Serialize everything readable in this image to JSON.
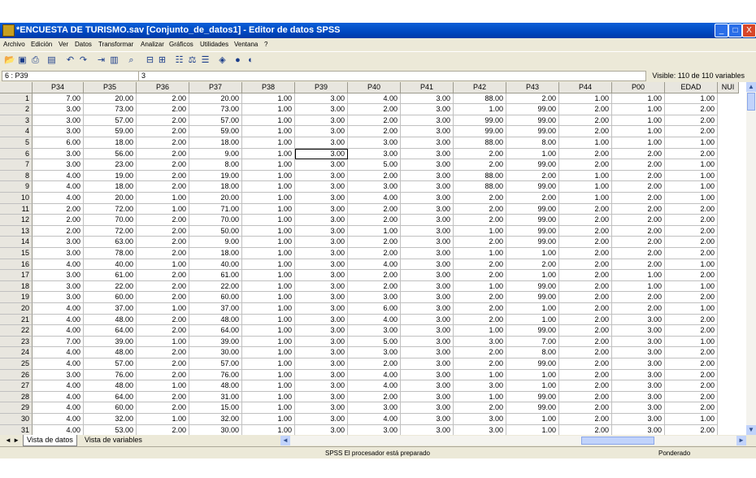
{
  "window": {
    "title": "*ENCUESTA DE TURISMO.sav [Conjunto_de_datos1] - Editor de datos SPSS",
    "buttons": [
      "_",
      "□",
      "X"
    ]
  },
  "menu": [
    "Archivo",
    "Edición",
    "Ver",
    "Datos",
    "Transformar",
    "Analizar",
    "Gráficos",
    "Utilidades",
    "Ventana",
    "?"
  ],
  "toolbar": [
    "open-icon",
    "save-icon",
    "print-icon",
    "dialog-recall-icon",
    "undo-icon",
    "redo-icon",
    "goto-case-icon",
    "variables-icon",
    "find-icon",
    "insert-cases-icon",
    "insert-variable-icon",
    "split-file-icon",
    "weight-cases-icon",
    "select-cases-icon",
    "value-labels-icon",
    "use-sets-icon",
    "show-all-icon"
  ],
  "cell_editor": {
    "ref": "6 : P39",
    "value": "3",
    "visible": "Visible: 110 de 110 variables"
  },
  "grid": {
    "columns": [
      "P34",
      "P35",
      "P36",
      "P37",
      "P38",
      "P39",
      "P40",
      "P41",
      "P42",
      "P43",
      "P44",
      "P00",
      "EDAD",
      "NUI"
    ],
    "rows": [
      [
        "1",
        "7.00",
        "20.00",
        "2.00",
        "20.00",
        "1.00",
        "3.00",
        "4.00",
        "3.00",
        "88.00",
        "2.00",
        "1.00",
        "1.00",
        "1.00"
      ],
      [
        "2",
        "3.00",
        "73.00",
        "2.00",
        "73.00",
        "1.00",
        "3.00",
        "2.00",
        "3.00",
        "1.00",
        "99.00",
        "2.00",
        "1.00",
        "2.00"
      ],
      [
        "3",
        "3.00",
        "57.00",
        "2.00",
        "57.00",
        "1.00",
        "3.00",
        "2.00",
        "3.00",
        "99.00",
        "99.00",
        "2.00",
        "1.00",
        "2.00"
      ],
      [
        "4",
        "3.00",
        "59.00",
        "2.00",
        "59.00",
        "1.00",
        "3.00",
        "2.00",
        "3.00",
        "99.00",
        "99.00",
        "2.00",
        "1.00",
        "2.00"
      ],
      [
        "5",
        "6.00",
        "18.00",
        "2.00",
        "18.00",
        "1.00",
        "3.00",
        "3.00",
        "3.00",
        "88.00",
        "8.00",
        "1.00",
        "1.00",
        "1.00"
      ],
      [
        "6",
        "3.00",
        "56.00",
        "2.00",
        "9.00",
        "1.00",
        "3.00",
        "3.00",
        "3.00",
        "2.00",
        "1.00",
        "2.00",
        "2.00",
        "2.00"
      ],
      [
        "7",
        "3.00",
        "23.00",
        "2.00",
        "8.00",
        "1.00",
        "3.00",
        "5.00",
        "3.00",
        "2.00",
        "99.00",
        "2.00",
        "2.00",
        "1.00"
      ],
      [
        "8",
        "4.00",
        "19.00",
        "2.00",
        "19.00",
        "1.00",
        "3.00",
        "2.00",
        "3.00",
        "88.00",
        "2.00",
        "1.00",
        "2.00",
        "1.00"
      ],
      [
        "9",
        "4.00",
        "18.00",
        "2.00",
        "18.00",
        "1.00",
        "3.00",
        "3.00",
        "3.00",
        "88.00",
        "99.00",
        "1.00",
        "2.00",
        "1.00"
      ],
      [
        "10",
        "4.00",
        "20.00",
        "1.00",
        "20.00",
        "1.00",
        "3.00",
        "4.00",
        "3.00",
        "2.00",
        "2.00",
        "1.00",
        "2.00",
        "1.00"
      ],
      [
        "11",
        "2.00",
        "72.00",
        "1.00",
        "71.00",
        "1.00",
        "3.00",
        "2.00",
        "3.00",
        "2.00",
        "99.00",
        "2.00",
        "2.00",
        "2.00"
      ],
      [
        "12",
        "2.00",
        "70.00",
        "2.00",
        "70.00",
        "1.00",
        "3.00",
        "2.00",
        "3.00",
        "2.00",
        "99.00",
        "2.00",
        "2.00",
        "2.00"
      ],
      [
        "13",
        "2.00",
        "72.00",
        "2.00",
        "50.00",
        "1.00",
        "3.00",
        "1.00",
        "3.00",
        "1.00",
        "99.00",
        "2.00",
        "2.00",
        "2.00"
      ],
      [
        "14",
        "3.00",
        "63.00",
        "2.00",
        "9.00",
        "1.00",
        "3.00",
        "2.00",
        "3.00",
        "2.00",
        "99.00",
        "2.00",
        "2.00",
        "2.00"
      ],
      [
        "15",
        "3.00",
        "78.00",
        "2.00",
        "18.00",
        "1.00",
        "3.00",
        "2.00",
        "3.00",
        "1.00",
        "1.00",
        "2.00",
        "2.00",
        "2.00"
      ],
      [
        "16",
        "4.00",
        "40.00",
        "1.00",
        "40.00",
        "1.00",
        "3.00",
        "4.00",
        "3.00",
        "2.00",
        "2.00",
        "2.00",
        "2.00",
        "1.00"
      ],
      [
        "17",
        "3.00",
        "61.00",
        "2.00",
        "61.00",
        "1.00",
        "3.00",
        "2.00",
        "3.00",
        "2.00",
        "1.00",
        "2.00",
        "1.00",
        "2.00"
      ],
      [
        "18",
        "3.00",
        "22.00",
        "2.00",
        "22.00",
        "1.00",
        "3.00",
        "2.00",
        "3.00",
        "1.00",
        "99.00",
        "2.00",
        "1.00",
        "1.00"
      ],
      [
        "19",
        "3.00",
        "60.00",
        "2.00",
        "60.00",
        "1.00",
        "3.00",
        "3.00",
        "3.00",
        "2.00",
        "99.00",
        "2.00",
        "2.00",
        "2.00"
      ],
      [
        "20",
        "4.00",
        "37.00",
        "1.00",
        "37.00",
        "1.00",
        "3.00",
        "6.00",
        "3.00",
        "2.00",
        "1.00",
        "2.00",
        "2.00",
        "1.00"
      ],
      [
        "21",
        "4.00",
        "48.00",
        "2.00",
        "48.00",
        "1.00",
        "3.00",
        "4.00",
        "3.00",
        "2.00",
        "1.00",
        "2.00",
        "3.00",
        "2.00"
      ],
      [
        "22",
        "4.00",
        "64.00",
        "2.00",
        "64.00",
        "1.00",
        "3.00",
        "3.00",
        "3.00",
        "1.00",
        "99.00",
        "2.00",
        "3.00",
        "2.00"
      ],
      [
        "23",
        "7.00",
        "39.00",
        "1.00",
        "39.00",
        "1.00",
        "3.00",
        "5.00",
        "3.00",
        "3.00",
        "7.00",
        "2.00",
        "3.00",
        "1.00"
      ],
      [
        "24",
        "4.00",
        "48.00",
        "2.00",
        "30.00",
        "1.00",
        "3.00",
        "3.00",
        "3.00",
        "2.00",
        "8.00",
        "2.00",
        "3.00",
        "2.00"
      ],
      [
        "25",
        "4.00",
        "57.00",
        "2.00",
        "57.00",
        "1.00",
        "3.00",
        "2.00",
        "3.00",
        "2.00",
        "99.00",
        "2.00",
        "3.00",
        "2.00"
      ],
      [
        "26",
        "3.00",
        "76.00",
        "2.00",
        "76.00",
        "1.00",
        "3.00",
        "4.00",
        "3.00",
        "1.00",
        "1.00",
        "2.00",
        "3.00",
        "2.00"
      ],
      [
        "27",
        "4.00",
        "48.00",
        "1.00",
        "48.00",
        "1.00",
        "3.00",
        "4.00",
        "3.00",
        "3.00",
        "1.00",
        "2.00",
        "3.00",
        "2.00"
      ],
      [
        "28",
        "4.00",
        "64.00",
        "2.00",
        "31.00",
        "1.00",
        "3.00",
        "2.00",
        "3.00",
        "1.00",
        "99.00",
        "2.00",
        "3.00",
        "2.00"
      ],
      [
        "29",
        "4.00",
        "60.00",
        "2.00",
        "15.00",
        "1.00",
        "3.00",
        "3.00",
        "3.00",
        "2.00",
        "99.00",
        "2.00",
        "3.00",
        "2.00"
      ],
      [
        "30",
        "4.00",
        "32.00",
        "1.00",
        "32.00",
        "1.00",
        "3.00",
        "4.00",
        "3.00",
        "3.00",
        "1.00",
        "2.00",
        "3.00",
        "1.00"
      ],
      [
        "31",
        "4.00",
        "53.00",
        "2.00",
        "30.00",
        "1.00",
        "3.00",
        "3.00",
        "3.00",
        "3.00",
        "1.00",
        "2.00",
        "3.00",
        "2.00"
      ]
    ],
    "selected_cell": {
      "row": 6,
      "column": "P39"
    }
  },
  "tabs": [
    "Vista de datos",
    "Vista de variables"
  ],
  "status": {
    "processor": "SPSS El procesador  está preparado",
    "weight": "Ponderado"
  }
}
